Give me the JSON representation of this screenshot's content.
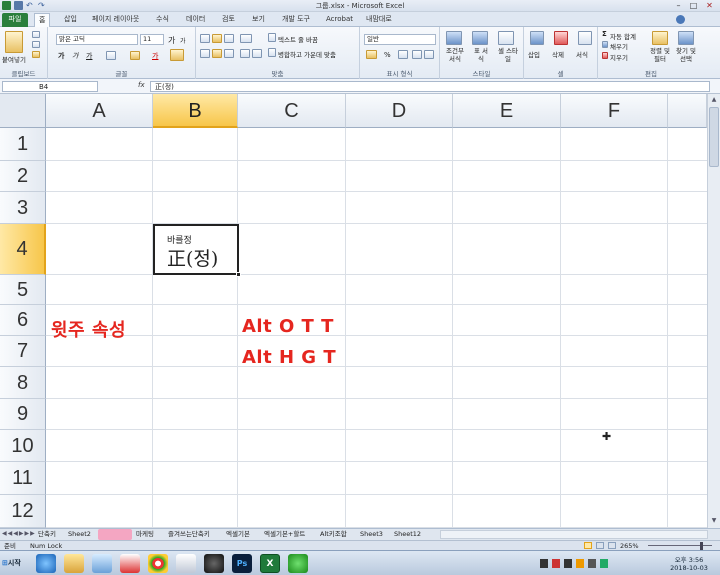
{
  "window": {
    "title": "그룹.xlsx - Microsoft Excel",
    "minimize": "–",
    "maximize": "□",
    "close": "✕"
  },
  "tabs": {
    "file": "파일",
    "items": [
      "홈",
      "삽입",
      "페이지 레이아웃",
      "수식",
      "데이터",
      "검토",
      "보기",
      "개발 도구",
      "Acrobat",
      "내맘대로"
    ]
  },
  "ribbon": {
    "clipboard": {
      "paste": "붙여넣기",
      "label": "클립보드"
    },
    "font": {
      "name": "맑은 고딕",
      "size": "11",
      "label": "글꼴",
      "bold": "가",
      "italic": "가",
      "underline": "가",
      "grow": "가",
      "shrink": "가",
      "fontcolor": "가"
    },
    "alignment": {
      "wrap": "텍스트 줄 바꿈",
      "merge": "병합하고 가운데 맞춤",
      "label": "맞춤"
    },
    "number": {
      "format": "일반",
      "label": "표시 형식",
      "percent": "%"
    },
    "styles": {
      "conditional": "조건부 서식",
      "table": "표 서식",
      "cell": "셀 스타일",
      "label": "스타일"
    },
    "cells": {
      "insert": "삽입",
      "delete": "삭제",
      "format": "서식",
      "label": "셀"
    },
    "editing": {
      "autosum": "자동 합계",
      "fill": "채우기",
      "clear": "지우기",
      "sort": "정렬 및 필터",
      "find": "찾기 및 선택",
      "label": "편집"
    }
  },
  "formula_bar": {
    "name_box": "B4",
    "fx": "fx",
    "formula": "正(정)"
  },
  "grid": {
    "columns": [
      "A",
      "B",
      "C",
      "D",
      "E",
      "F"
    ],
    "rows": [
      "1",
      "2",
      "3",
      "4",
      "5",
      "6",
      "7",
      "8",
      "9",
      "10",
      "11",
      "12"
    ],
    "selected_column": "B",
    "selected_row": "4",
    "b4_ruby": "바를정",
    "b4_value": "正(정)",
    "a6": "윗주 속성",
    "c6": "Alt O T T",
    "c7": "Alt H G T"
  },
  "sheets": [
    "단축키",
    "Sheet2",
    "",
    "마케팅",
    "즐겨쓰는단축키",
    "엑셀기본",
    "엑셀기본+할트",
    "Alt키조합",
    "Sheet3",
    "Sheet12"
  ],
  "status": {
    "ready": "준비",
    "numlock": "Num Lock",
    "zoom": "265%"
  },
  "taskbar": {
    "start": "시작",
    "time": "오후 3:56",
    "date": "2018-10-03"
  },
  "colors": {
    "accent_red": "#e5261f",
    "excel_green": "#2a7f3c",
    "selection": "#f7c64a"
  }
}
